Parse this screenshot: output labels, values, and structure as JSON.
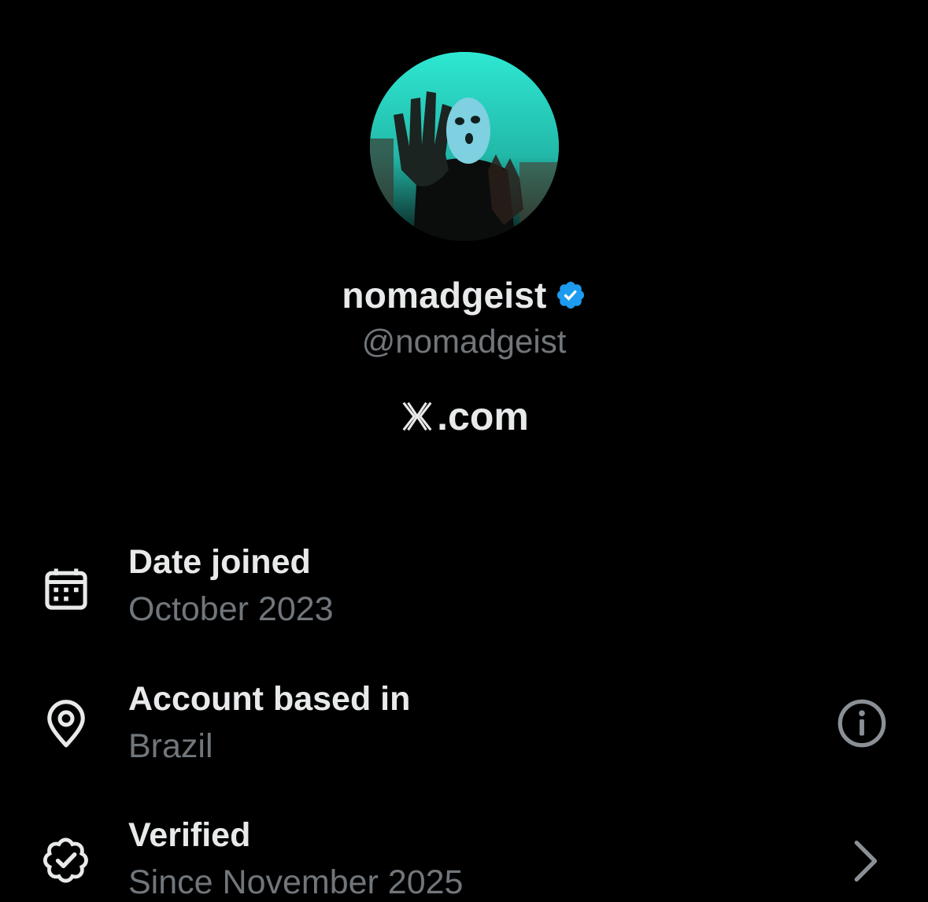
{
  "profile": {
    "display_name": "nomadgeist",
    "handle": "@nomadgeist",
    "verified_badge_color": "#1d9bf0",
    "avatar_icon": "avatar-photo"
  },
  "site": {
    "text": ".com",
    "logo_icon": "x-logo-icon"
  },
  "about_rows": [
    {
      "icon": "calendar-icon",
      "label": "Date joined",
      "value": "October 2023"
    },
    {
      "icon": "location-pin-icon",
      "label": "Account based in",
      "value": "Brazil",
      "trailing_icon": "info-icon"
    },
    {
      "icon": "verified-outline-icon",
      "label": "Verified",
      "value": "Since November 2025",
      "trailing_icon": "chevron-right-icon"
    }
  ],
  "colors": {
    "background": "#000000",
    "primary_text": "#e7e9ea",
    "secondary_text": "#71767b",
    "accent": "#1d9bf0"
  }
}
